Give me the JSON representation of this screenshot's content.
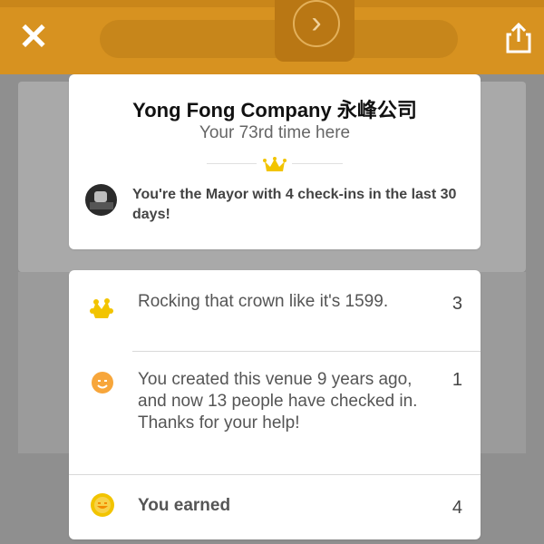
{
  "header": {
    "close_label": "✕"
  },
  "venue_card": {
    "title": "Yong Fong Company 永峰公司",
    "subtitle": "Your 73rd time here",
    "mayor_text": "You're the Mayor with 4 check-ins in the last 30 days!"
  },
  "stats": [
    {
      "icon": "crown-sticker-icon",
      "text": "Rocking that crown like it's 1599.",
      "count": "3"
    },
    {
      "icon": "smiley-face-icon",
      "text": "You created this venue 9 years ago, and now 13 people have checked in. Thanks for your help!",
      "count": "1"
    },
    {
      "icon": "coin-icon",
      "text": "You earned",
      "count": "4"
    }
  ],
  "colors": {
    "brand_orange": "#d79220",
    "crown_yellow": "#f2c400",
    "smiley_orange": "#f7a63b"
  }
}
